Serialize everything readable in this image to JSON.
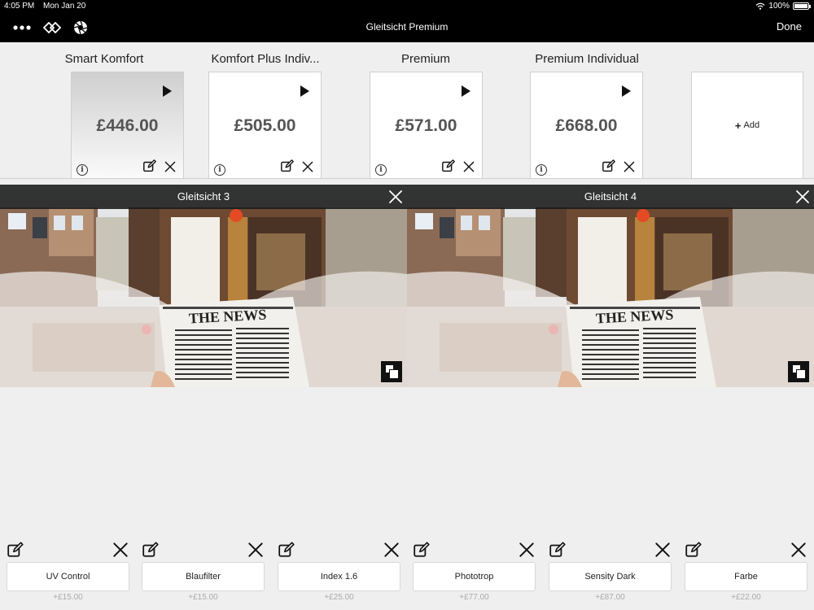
{
  "status_bar": {
    "time": "4:05 PM",
    "date": "Mon Jan 20",
    "battery": "100%"
  },
  "nav": {
    "title": "Gleitsicht Premium",
    "done_label": "Done"
  },
  "packages": [
    {
      "title": "Smart  Komfort",
      "price": "£446.00",
      "selected": true
    },
    {
      "title": "Komfort Plus Indiv...",
      "price": "£505.00",
      "selected": false
    },
    {
      "title": "Premium",
      "price": "£571.00",
      "selected": false
    },
    {
      "title": "Premium Individual",
      "price": "£668.00",
      "selected": false
    }
  ],
  "add_label": "Add",
  "lenses": [
    {
      "title": "Gleitsicht 3",
      "newspaper_headline": "THE NEWS"
    },
    {
      "title": "Gleitsicht 4",
      "newspaper_headline": "THE NEWS"
    }
  ],
  "options": [
    {
      "label": "UV Control",
      "price": "+£15.00"
    },
    {
      "label": "Blaufilter",
      "price": "+£15.00"
    },
    {
      "label": "Index 1.6",
      "price": "+£25.00"
    },
    {
      "label": "Phototrop",
      "price": "+£77.00"
    },
    {
      "label": "Sensity Dark",
      "price": "+£87.00"
    },
    {
      "label": "Farbe",
      "price": "+£22.00"
    }
  ],
  "colors": {
    "nav_bg": "#000000",
    "panel_bg": "#efefef",
    "price_text": "#555555"
  }
}
